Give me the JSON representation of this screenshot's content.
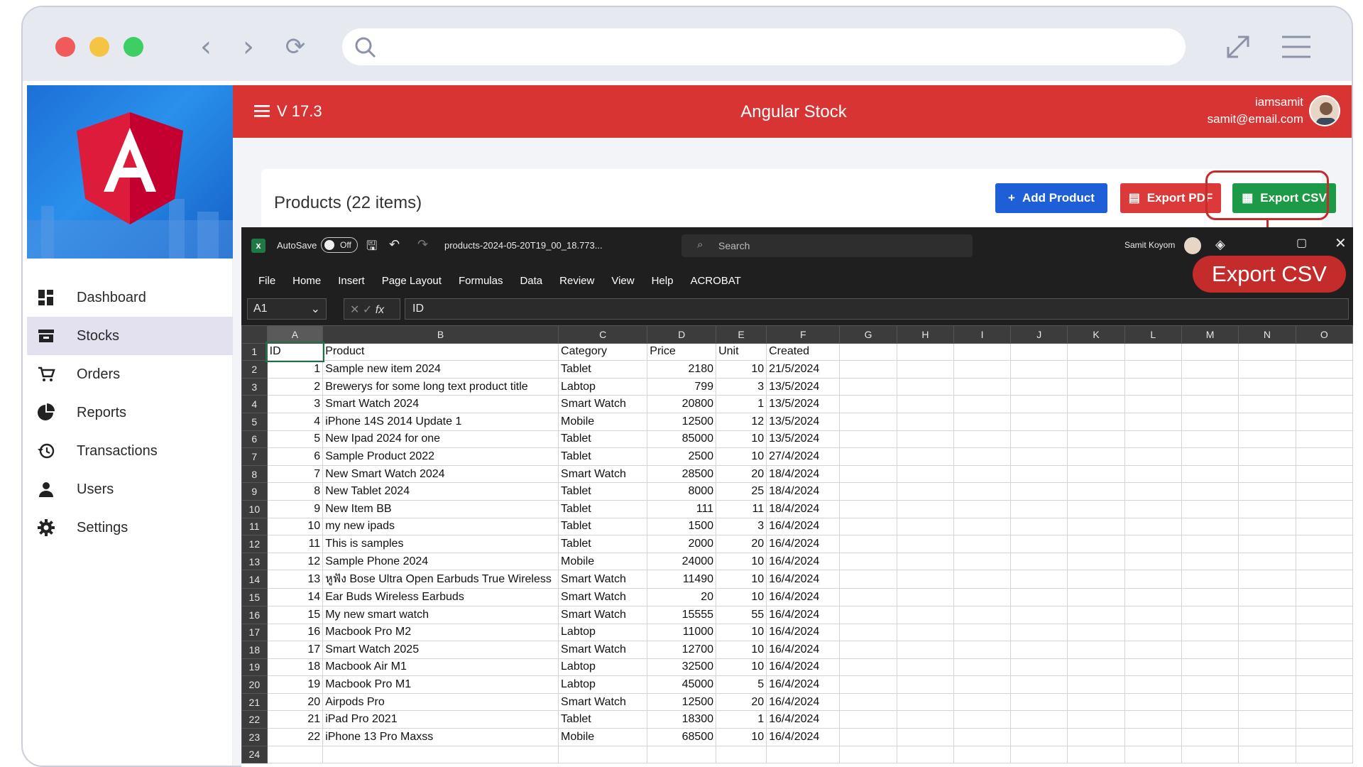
{
  "browser": {
    "icons": [
      "back-icon",
      "forward-icon",
      "reload-icon",
      "search-icon",
      "expand-icon",
      "menu-icon"
    ]
  },
  "sidebar": {
    "items": [
      {
        "label": "Dashboard",
        "icon": "dashboard-icon"
      },
      {
        "label": "Stocks",
        "icon": "stocks-icon",
        "active": true
      },
      {
        "label": "Orders",
        "icon": "cart-icon"
      },
      {
        "label": "Reports",
        "icon": "pie-chart-icon"
      },
      {
        "label": "Transactions",
        "icon": "history-icon"
      },
      {
        "label": "Users",
        "icon": "user-icon"
      },
      {
        "label": "Settings",
        "icon": "gear-icon"
      }
    ]
  },
  "header": {
    "version": "V 17.3",
    "title": "Angular Stock",
    "username": "iamsamit",
    "email": "samit@email.com"
  },
  "products": {
    "title": "Products (22 items)",
    "add_label": "Add Product",
    "pdf_label": "Export PDF",
    "csv_label": "Export CSV"
  },
  "callout": {
    "label": "Export CSV"
  },
  "excel": {
    "autosave_label": "AutoSave",
    "autosave_state": "Off",
    "filename": "products-2024-05-20T19_00_18.773...",
    "search_placeholder": "Search",
    "user": "Samit Koyom",
    "menu": [
      "File",
      "Home",
      "Insert",
      "Page Layout",
      "Formulas",
      "Data",
      "Review",
      "View",
      "Help",
      "ACROBAT"
    ],
    "namebox": "A1",
    "formula": "ID",
    "columns": [
      "A",
      "B",
      "C",
      "D",
      "E",
      "F",
      "G",
      "H",
      "I",
      "J",
      "K",
      "L",
      "M",
      "N",
      "O"
    ],
    "rows": [
      [
        "ID",
        "Product",
        "Category",
        "Price",
        "Unit",
        "Created"
      ],
      [
        "1",
        "Sample new item 2024",
        "Tablet",
        "2180",
        "10",
        "21/5/2024"
      ],
      [
        "2",
        "Brewerys for some long text product title",
        "Labtop",
        "799",
        "3",
        "13/5/2024"
      ],
      [
        "3",
        "Smart Watch 2024",
        "Smart Watch",
        "20800",
        "1",
        "13/5/2024"
      ],
      [
        "4",
        "iPhone 14S 2014 Update 1",
        "Mobile",
        "12500",
        "12",
        "13/5/2024"
      ],
      [
        "5",
        "New Ipad 2024 for one",
        "Tablet",
        "85000",
        "10",
        "13/5/2024"
      ],
      [
        "6",
        "Sample Product 2022",
        "Tablet",
        "2500",
        "10",
        "27/4/2024"
      ],
      [
        "7",
        "New Smart Watch 2024",
        "Smart Watch",
        "28500",
        "20",
        "18/4/2024"
      ],
      [
        "8",
        "New Tablet 2024",
        "Tablet",
        "8000",
        "25",
        "18/4/2024"
      ],
      [
        "9",
        "New Item BB",
        "Tablet",
        "111",
        "11",
        "18/4/2024"
      ],
      [
        "10",
        "my new ipads",
        "Tablet",
        "1500",
        "3",
        "16/4/2024"
      ],
      [
        "11",
        "This is samples",
        "Tablet",
        "2000",
        "20",
        "16/4/2024"
      ],
      [
        "12",
        "Sample Phone 2024",
        "Mobile",
        "24000",
        "10",
        "16/4/2024"
      ],
      [
        "13",
        "หูฟัง Bose Ultra Open Earbuds True Wireless",
        "Smart Watch",
        "11490",
        "10",
        "16/4/2024"
      ],
      [
        "14",
        "Ear Buds Wireless Earbuds",
        "Smart Watch",
        "20",
        "10",
        "16/4/2024"
      ],
      [
        "15",
        "My new smart watch",
        "Smart Watch",
        "15555",
        "55",
        "16/4/2024"
      ],
      [
        "16",
        "Macbook Pro M2",
        "Labtop",
        "11000",
        "10",
        "16/4/2024"
      ],
      [
        "17",
        "Smart Watch 2025",
        "Smart Watch",
        "12700",
        "10",
        "16/4/2024"
      ],
      [
        "18",
        "Macbook Air M1",
        "Labtop",
        "32500",
        "10",
        "16/4/2024"
      ],
      [
        "19",
        "Macbook Pro M1",
        "Labtop",
        "45000",
        "5",
        "16/4/2024"
      ],
      [
        "20",
        "Airpods Pro",
        "Smart Watch",
        "12500",
        "20",
        "16/4/2024"
      ],
      [
        "21",
        "iPad Pro 2021",
        "Tablet",
        "18300",
        "1",
        "16/4/2024"
      ],
      [
        "22",
        "iPhone 13 Pro Maxss",
        "Mobile",
        "68500",
        "10",
        "16/4/2024"
      ],
      [
        "",
        "",
        "",
        "",
        "",
        ""
      ]
    ]
  }
}
